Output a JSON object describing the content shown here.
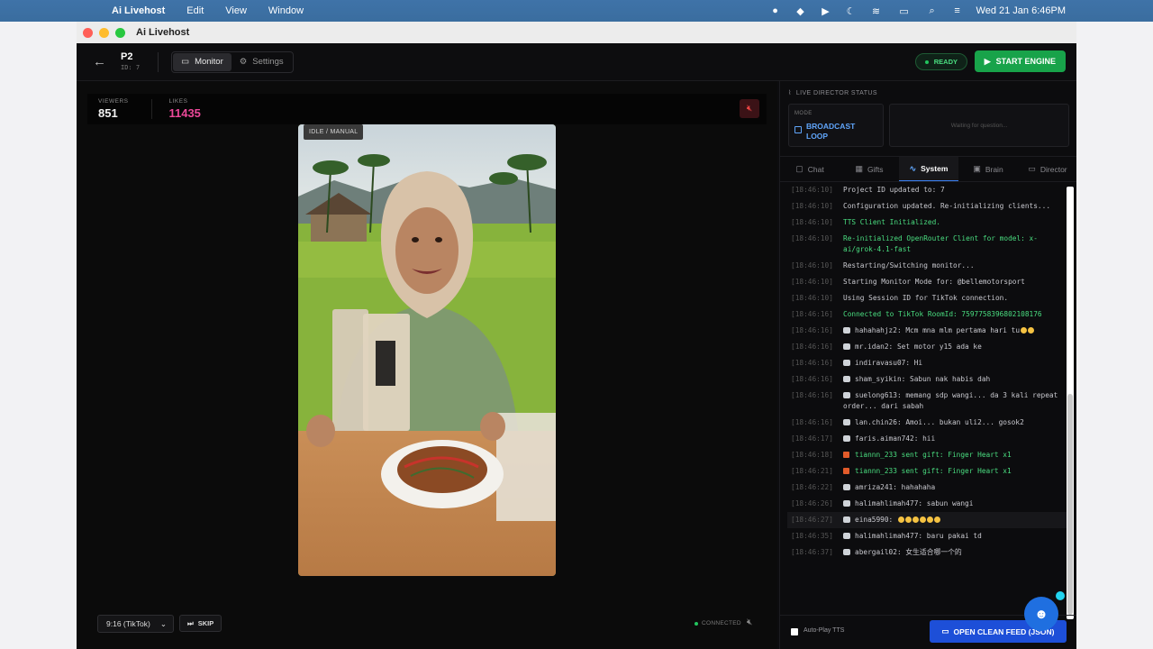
{
  "menubar": {
    "app_name": "Ai Livehost",
    "menus": [
      "Edit",
      "View",
      "Window"
    ],
    "clock": "Wed 21 Jan  6:46PM"
  },
  "window": {
    "title": "Ai Livehost"
  },
  "header": {
    "project_name": "P2",
    "project_id": "ID: 7",
    "tabs": [
      {
        "label": "Monitor"
      },
      {
        "label": "Settings"
      }
    ],
    "status": "READY",
    "start_button": "START ENGINE"
  },
  "stage": {
    "viewers_label": "VIEWERS",
    "viewers": "851",
    "likes_label": "LIKES",
    "likes": "11435",
    "mode_badge": "IDLE / MANUAL",
    "aspect": "9:16 (TikTok)",
    "skip": "SKIP",
    "connection": "CONNECTED"
  },
  "director": {
    "heading": "LIVE DIRECTOR STATUS",
    "mode_label": "MODE",
    "mode_value_line1": "BROADCAST",
    "mode_value_line2": "LOOP",
    "waiting": "Waiting for question..."
  },
  "side_tabs": [
    {
      "label": "Chat"
    },
    {
      "label": "Gifts"
    },
    {
      "label": "System"
    },
    {
      "label": "Brain"
    },
    {
      "label": "Director"
    }
  ],
  "log": [
    {
      "time": "[18:46:10]",
      "msg": "Project ID updated to: 7",
      "type": "sys"
    },
    {
      "time": "[18:46:10]",
      "msg": "Configuration updated. Re-initializing clients...",
      "type": "sys"
    },
    {
      "time": "[18:46:10]",
      "msg": "TTS Client Initialized.",
      "type": "ok"
    },
    {
      "time": "[18:46:10]",
      "msg": "Re-initialized OpenRouter Client for model: x-ai/grok-4.1-fast",
      "type": "ok"
    },
    {
      "time": "[18:46:10]",
      "msg": "Restarting/Switching monitor...",
      "type": "sys"
    },
    {
      "time": "[18:46:10]",
      "msg": "Starting Monitor Mode for: @bellemotorsport",
      "type": "sys"
    },
    {
      "time": "[18:46:10]",
      "msg": "Using Session ID for TikTok connection.",
      "type": "sys"
    },
    {
      "time": "[18:46:16]",
      "msg": "Connected to TikTok RoomId: 7597758396802108176",
      "type": "ok"
    },
    {
      "time": "[18:46:16]",
      "msg": "hahahahjz2: Mcm mna mlm pertama hari tu",
      "type": "chat",
      "emoji": 2
    },
    {
      "time": "[18:46:16]",
      "msg": "mr.idan2: Set motor y15 ada ke",
      "type": "chat"
    },
    {
      "time": "[18:46:16]",
      "msg": "indiravasu07: Hi",
      "type": "chat"
    },
    {
      "time": "[18:46:16]",
      "msg": "sham_syikin: Sabun nak habis dah",
      "type": "chat"
    },
    {
      "time": "[18:46:16]",
      "msg": "suelong613: memang sdp wangi... da 3 kali repeat order... dari sabah",
      "type": "chat"
    },
    {
      "time": "[18:46:16]",
      "msg": "lan.chin26: Amoi... bukan uli2... gosok2",
      "type": "chat"
    },
    {
      "time": "[18:46:17]",
      "msg": "faris.aiman742: hii",
      "type": "chat"
    },
    {
      "time": "[18:46:18]",
      "msg": "tiannn_233 sent gift: Finger Heart x1",
      "type": "gift"
    },
    {
      "time": "[18:46:21]",
      "msg": "tiannn_233 sent gift: Finger Heart x1",
      "type": "gift"
    },
    {
      "time": "[18:46:22]",
      "msg": "amriza241: hahahaha",
      "type": "chat"
    },
    {
      "time": "[18:46:26]",
      "msg": "halimahlimah477: sabun wangi",
      "type": "chat"
    },
    {
      "time": "[18:46:27]",
      "msg": "eina5990: ",
      "type": "chat",
      "emoji": 6,
      "highlight": true
    },
    {
      "time": "[18:46:35]",
      "msg": "halimahlimah477: baru pakai td",
      "type": "chat"
    },
    {
      "time": "[18:46:37]",
      "msg": "abergail02: 女生适合哪一个的",
      "type": "chat"
    }
  ],
  "footer": {
    "autoplay": "Auto-Play TTS",
    "open_feed": "OPEN CLEAN FEED (JSON)"
  },
  "colors": {
    "accent": "#1d4fd8",
    "green": "#18a34a",
    "likes": "#ec4899",
    "ok_text": "#4ade80"
  }
}
